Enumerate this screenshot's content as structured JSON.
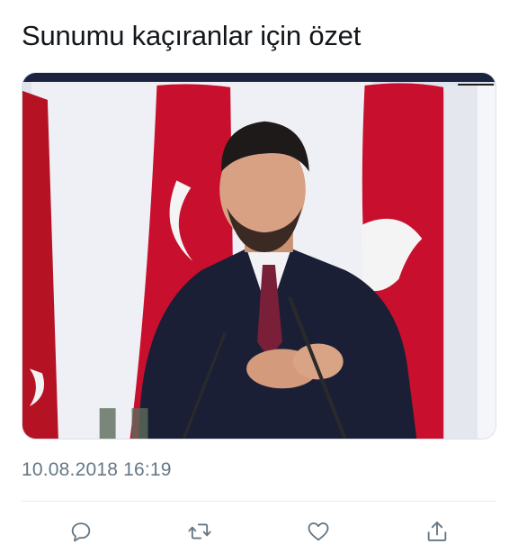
{
  "tweet": {
    "text": "Sunumu kaçıranlar için özet",
    "timestamp": "10.08.2018 16:19"
  },
  "media": {
    "description_icon": "photo-of-speaker-at-podium"
  },
  "actions": [
    {
      "name": "reply",
      "icon": "reply-icon"
    },
    {
      "name": "retweet",
      "icon": "retweet-icon"
    },
    {
      "name": "like",
      "icon": "heart-icon"
    },
    {
      "name": "share",
      "icon": "share-icon"
    }
  ],
  "colors": {
    "text": "#14171a",
    "muted": "#657786",
    "flag_red": "#c8102e",
    "divider": "#e6ecf0"
  }
}
